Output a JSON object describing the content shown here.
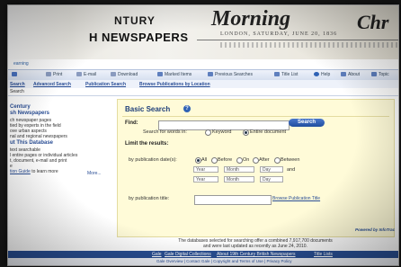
{
  "header": {
    "title_line1": "NTURY",
    "title_line2": "H NEWSPAPERS",
    "masthead1": "Morning",
    "masthead2": "Chr",
    "masthead_sub": "LONDON, SATURDAY, JUNE 20, 1836"
  },
  "top_text": "earning",
  "toolbar": [
    {
      "label": "",
      "icon": "home-icon",
      "color": "#4a74c4"
    },
    {
      "label": "Print",
      "icon": "print-icon",
      "color": "#8a9bbf"
    },
    {
      "label": "E-mail",
      "icon": "email-icon",
      "color": "#8a9bbf"
    },
    {
      "label": "Download",
      "icon": "download-icon",
      "color": "#8a9bbf"
    },
    {
      "label": "Marked Items",
      "icon": "marked-items-icon",
      "color": "#5e7fbe"
    },
    {
      "label": "Previous Searches",
      "icon": "previous-searches-icon",
      "color": "#5e7fbe"
    },
    {
      "label": "Title List",
      "icon": "title-list-icon",
      "color": "#5e7fbe"
    },
    {
      "label": "Help",
      "icon": "help-icon",
      "color": "#2f62b5"
    },
    {
      "label": "About",
      "icon": "about-icon",
      "color": "#5e7fbe"
    },
    {
      "label": "Topic",
      "icon": "topic-icon",
      "color": "#5e7fbe"
    }
  ],
  "nav": [
    "Search",
    "Advanced Search",
    "Publication Search",
    "Browse Publications by Location"
  ],
  "breadcrumb": "Search",
  "sidebar": {
    "heading1": "Century",
    "heading1b": "sh Newspapers",
    "desc": [
      "ch newspaper pages",
      "tied by experts in the field",
      "ove urban aspects",
      "nal and regional newspapers"
    ],
    "heading2": "ut This Database",
    "desc2": [
      "text searchable",
      "l entire pages or individual articles",
      "t, document, e-mail and print",
      "e"
    ],
    "guide_link": "tion Guide",
    "guide_rest": "to learn more",
    "more": "More..."
  },
  "form": {
    "title": "Basic Search",
    "help_icon": "?",
    "find_label": "Find:",
    "find_value": "",
    "search_button": "Search",
    "search_for_label": "Search for words in:",
    "keyword_option": "Keyword",
    "entire_doc_option": "Entire document",
    "limit_label": "Limit the results:",
    "pubdate_label": "by publication date(s):",
    "date_options": [
      "All",
      "Before",
      "On",
      "After",
      "Between"
    ],
    "year_placeholder": "Year",
    "month_placeholder": "Month",
    "day_placeholder": "Day",
    "and_label": "and",
    "pubtitle_label": "by publication title:",
    "browse_link": "Browse Publication Title",
    "powered_by": "Powered by InfoTrac"
  },
  "stats_line1": "The databases selected for searching offer a combined 7,917,700 documents",
  "stats_line2": "and were last updated as recently as June 24, 2010.",
  "footer": [
    "Gale",
    "Gale Digital Collections",
    "About 19th Century British Newspapers",
    "Title Lists"
  ],
  "subfooter": "Gale Overview | Contact Gale | Copyright and Terms of Use | Privacy Policy"
}
